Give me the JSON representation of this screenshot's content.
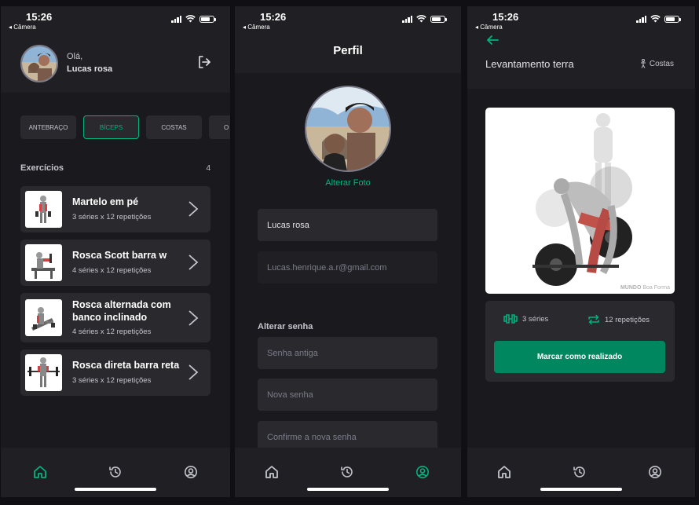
{
  "status": {
    "time": "15:26",
    "back_app": "◂ Câmera"
  },
  "home": {
    "greeting": "Olá,",
    "user_name": "Lucas rosa",
    "groups": [
      "ANTEBRAÇO",
      "BÍCEPS",
      "COSTAS",
      "O"
    ],
    "active_group": "BÍCEPS",
    "section_title": "Exercícios",
    "count": "4",
    "exercises": [
      {
        "name": "Martelo em pé",
        "meta": "3 séries x 12 repetições"
      },
      {
        "name": "Rosca Scott barra w",
        "meta": "4 séries x 12 repetições"
      },
      {
        "name": "Rosca alternada com banco inclinado",
        "meta": "4 séries x 12 repetições"
      },
      {
        "name": "Rosca direta barra reta",
        "meta": "3 séries x 12 repetições"
      }
    ]
  },
  "profile": {
    "title": "Perfil",
    "change_photo": "Alterar Foto",
    "name_value": "Lucas rosa",
    "email_value": "Lucas.henrique.a.r@gmail.com",
    "password_heading": "Alterar senha",
    "old_password_placeholder": "Senha antiga",
    "new_password_placeholder": "Nova senha",
    "confirm_password_placeholder": "Confirme a nova senha"
  },
  "exercise": {
    "title": "Levantamento terra",
    "group": "Costas",
    "watermark_bold": "MUNDO",
    "watermark_light": "Boa Forma",
    "series": "3 séries",
    "reps": "12 repetições",
    "done_label": "Marcar como realizado"
  },
  "colors": {
    "accent": "#00b37e",
    "button": "#00875f",
    "active_tab": "#00b37e"
  },
  "icons": {
    "tabs": [
      "home-icon",
      "history-icon",
      "profile-icon"
    ],
    "logout": "logout-icon",
    "chevron": "chevron-right-icon",
    "back": "arrow-left-icon",
    "group": "body-icon",
    "series": "dumbbell-icon",
    "reps": "repeat-icon"
  }
}
